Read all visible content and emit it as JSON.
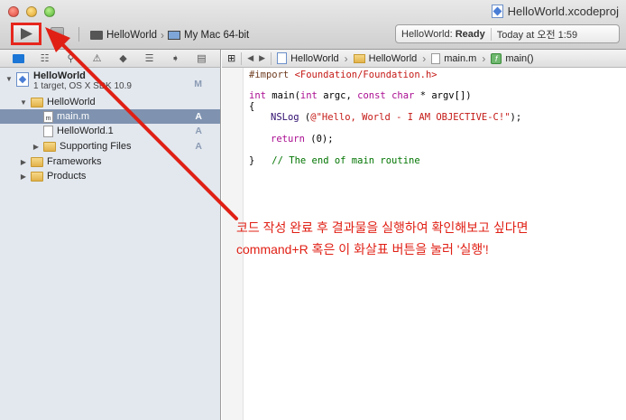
{
  "window": {
    "title": "HelloWorld.xcodeproj"
  },
  "toolbar": {
    "scheme_name": "HelloWorld",
    "destination": "My Mac 64-bit",
    "status_project": "HelloWorld:",
    "status_state": "Ready",
    "status_time": "Today at 오전 1:59"
  },
  "navigator": {
    "tabs": [
      "folder-icon",
      "hierarchy-icon",
      "search-icon",
      "warning-icon",
      "diamond-icon",
      "list-icon",
      "label-icon",
      "chat-icon"
    ],
    "project": {
      "name": "HelloWorld",
      "subtitle": "1 target, OS X SDK 10.9",
      "badge": "M"
    },
    "items": [
      {
        "label": "HelloWorld",
        "badge": ""
      },
      {
        "label": "main.m",
        "badge": "A"
      },
      {
        "label": "HelloWorld.1",
        "badge": "A"
      },
      {
        "label": "Supporting Files",
        "badge": "A"
      },
      {
        "label": "Frameworks",
        "badge": ""
      },
      {
        "label": "Products",
        "badge": ""
      }
    ]
  },
  "jumpbar": {
    "items": [
      "HelloWorld",
      "HelloWorld",
      "main.m",
      "main()"
    ]
  },
  "code": {
    "line1_directive": "#import ",
    "line1_path": "<Foundation/Foundation.h>",
    "line2_kw1": "int",
    "line2_rest1": " main(",
    "line2_kw2": "int",
    "line2_rest2": " argc, ",
    "line2_kw3": "const",
    "line2_rest3": " ",
    "line2_kw4": "char",
    "line2_rest4": " * argv[])",
    "line3": "{",
    "line4_fn": "NSLog",
    "line4_open": " (",
    "line4_str": "@\"Hello, World - I AM OBJECTIVE-C!\"",
    "line4_close": ");",
    "line5_kw": "return",
    "line5_rest": " (0);",
    "line6_brace": "}",
    "line6_comment": "// The end of main routine"
  },
  "annotation": {
    "line1": "코드 작성 완료 후 결과물을 실행하여 확인해보고 싶다면",
    "line2": "command+R 혹은 이 화살표 버튼을 눌러 '실행'!"
  },
  "colors": {
    "highlight_red": "#e6261d",
    "selection": "#7f93b0",
    "sidebar_bg": "#e3e8ef"
  }
}
